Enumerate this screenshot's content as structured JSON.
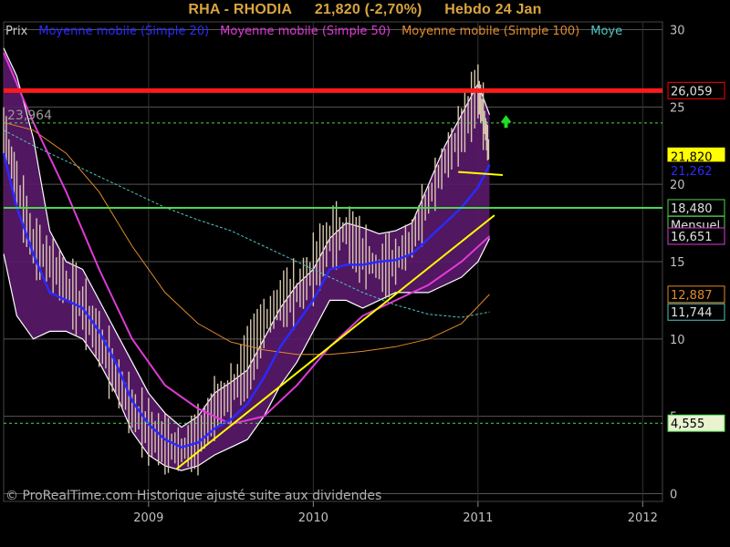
{
  "header": {
    "symbol": "RHA - RHODIA",
    "quote": "21,820 (-2,70%)",
    "period": "Hebdo  24 Jan"
  },
  "legend": [
    {
      "label": "Prix",
      "color": "#c8c8c8"
    },
    {
      "label": "Moyenne mobile (Simple 20)",
      "color": "#2a2aff"
    },
    {
      "label": "Moyenne mobile (Simple 50)",
      "color": "#e03ad8"
    },
    {
      "label": "Moyenne mobile (Simple 100)",
      "color": "#e08a2a"
    },
    {
      "label": "Moye",
      "color": "#4fc6c0"
    }
  ],
  "watermark": "© ProRealTime.com Historique ajusté suite aux dividendes",
  "left_level_label": "23,964",
  "price_tags": [
    {
      "label": "26,059",
      "bg": "#000000",
      "fg": "#e0e0e0",
      "border": "#ff0000",
      "value": 26.059
    },
    {
      "label": "21,820",
      "bg": "#ffff00",
      "fg": "#000000",
      "border": "#ffff00",
      "value": 21.82
    },
    {
      "label": "21,262",
      "bg": "#000000",
      "fg": "#2a2aff",
      "border": "#000000",
      "value": 20.9
    },
    {
      "label": "18,480",
      "bg": "#000000",
      "fg": "#e0e0e0",
      "border": "#4cd84c",
      "value": 18.48
    },
    {
      "label": "Mensuel",
      "bg": "#000000",
      "fg": "#e0e0e0",
      "border": "#4cd84c",
      "value": 17.4
    },
    {
      "label": "16,651",
      "bg": "#000000",
      "fg": "#e0e0e0",
      "border": "#e03ad8",
      "value": 16.651
    },
    {
      "label": "12,887",
      "bg": "#000000",
      "fg": "#e08a2a",
      "border": "#e08a2a",
      "value": 12.887
    },
    {
      "label": "11,744",
      "bg": "#000000",
      "fg": "#e0e0e0",
      "border": "#4fc6c0",
      "value": 11.744
    },
    {
      "label": "4,555",
      "bg": "#e8f3d0",
      "fg": "#000000",
      "border": "#4cd84c",
      "value": 4.555
    }
  ],
  "colors": {
    "background": "#000000",
    "price": "#d8c8b0",
    "band_fill": "#5a1a6a",
    "band_edge": "#ffffff",
    "sma20": "#2a2aff",
    "sma50": "#e03ad8",
    "sma100": "#e08a2a",
    "sma200": "#4fc6c0",
    "resistance": "#ff1a1a",
    "support_monthly": "#4cd84c",
    "trendline": "#ffff00",
    "grid": "#555555",
    "axis_text": "#c0c0c0"
  },
  "chart_data": {
    "type": "line",
    "xlim": [
      2008.12,
      2012.12
    ],
    "ylim": [
      -0.5,
      30.5
    ],
    "y_ticks": [
      0,
      5,
      10,
      15,
      20,
      25,
      30
    ],
    "x_ticks": [
      {
        "label": "2009",
        "value": 2009.0
      },
      {
        "label": "2010",
        "value": 2010.0
      },
      {
        "label": "2011",
        "value": 2011.0
      },
      {
        "label": "2012",
        "value": 2012.0
      }
    ],
    "series": [
      {
        "key": "price",
        "x": [
          2008.12,
          2008.2,
          2008.3,
          2008.4,
          2008.5,
          2008.6,
          2008.7,
          2008.8,
          2008.9,
          2009.0,
          2009.1,
          2009.2,
          2009.3,
          2009.4,
          2009.5,
          2009.6,
          2009.7,
          2009.8,
          2009.9,
          2010.0,
          2010.1,
          2010.2,
          2010.3,
          2010.4,
          2010.5,
          2010.6,
          2010.7,
          2010.8,
          2010.9,
          2011.0,
          2011.04,
          2011.07
        ],
        "y": [
          23.5,
          20.0,
          16.0,
          15.0,
          13.5,
          12.0,
          10.0,
          7.5,
          5.5,
          4.0,
          3.2,
          2.8,
          3.5,
          5.5,
          6.5,
          8.5,
          11.0,
          12.5,
          13.0,
          14.5,
          16.5,
          17.0,
          15.5,
          14.5,
          15.0,
          16.5,
          19.0,
          21.5,
          23.5,
          26.0,
          24.0,
          21.82
        ]
      },
      {
        "key": "sma20",
        "x": [
          2008.12,
          2008.2,
          2008.3,
          2008.4,
          2008.5,
          2008.6,
          2008.7,
          2008.8,
          2008.9,
          2009.0,
          2009.1,
          2009.2,
          2009.3,
          2009.4,
          2009.5,
          2009.6,
          2009.7,
          2009.8,
          2009.9,
          2010.0,
          2010.1,
          2010.2,
          2010.3,
          2010.4,
          2010.5,
          2010.6,
          2010.7,
          2010.8,
          2010.9,
          2011.0,
          2011.07
        ],
        "y": [
          22.0,
          18.5,
          15.5,
          13.0,
          12.5,
          12.0,
          10.5,
          8.5,
          6.0,
          4.5,
          3.5,
          3.0,
          3.3,
          4.2,
          4.8,
          5.8,
          7.5,
          9.5,
          11.0,
          12.5,
          14.5,
          14.8,
          14.8,
          15.0,
          15.1,
          15.5,
          16.5,
          17.5,
          18.5,
          19.8,
          21.26
        ]
      },
      {
        "key": "sma50",
        "x": [
          2008.12,
          2008.3,
          2008.5,
          2008.7,
          2008.9,
          2009.1,
          2009.3,
          2009.5,
          2009.7,
          2009.9,
          2010.1,
          2010.3,
          2010.5,
          2010.7,
          2010.9,
          2011.07
        ],
        "y": [
          28.5,
          24.0,
          19.5,
          14.5,
          10.0,
          7.0,
          5.5,
          4.5,
          5.0,
          7.0,
          9.5,
          11.5,
          12.5,
          13.5,
          15.0,
          16.651
        ]
      },
      {
        "key": "sma100",
        "x": [
          2008.12,
          2008.3,
          2008.5,
          2008.7,
          2008.9,
          2009.1,
          2009.3,
          2009.5,
          2009.7,
          2009.9,
          2010.1,
          2010.3,
          2010.5,
          2010.7,
          2010.9,
          2011.07
        ],
        "y": [
          24.0,
          23.5,
          22.0,
          19.5,
          16.0,
          13.0,
          11.0,
          9.8,
          9.3,
          9.0,
          9.0,
          9.2,
          9.5,
          10.0,
          11.0,
          12.887
        ]
      },
      {
        "key": "sma200",
        "x": [
          2008.12,
          2008.3,
          2008.5,
          2008.7,
          2008.9,
          2009.1,
          2009.3,
          2009.5,
          2009.7,
          2009.9,
          2010.1,
          2010.3,
          2010.5,
          2010.7,
          2010.9,
          2011.07
        ],
        "y": [
          23.5,
          22.5,
          21.5,
          20.5,
          19.5,
          18.5,
          17.7,
          17.0,
          16.0,
          15.0,
          14.0,
          13.0,
          12.2,
          11.6,
          11.4,
          11.744
        ]
      },
      {
        "key": "band_upper",
        "x": [
          2008.12,
          2008.2,
          2008.3,
          2008.4,
          2008.5,
          2008.6,
          2008.7,
          2008.8,
          2008.9,
          2009.0,
          2009.1,
          2009.2,
          2009.3,
          2009.4,
          2009.5,
          2009.6,
          2009.7,
          2009.8,
          2009.9,
          2010.0,
          2010.1,
          2010.2,
          2010.3,
          2010.4,
          2010.5,
          2010.6,
          2010.7,
          2010.8,
          2010.9,
          2011.0,
          2011.07
        ],
        "y": [
          28.8,
          27.0,
          23.0,
          17.0,
          15.0,
          14.5,
          12.5,
          10.5,
          8.5,
          6.5,
          5.2,
          4.3,
          5.0,
          6.5,
          7.2,
          8.0,
          10.0,
          12.0,
          13.5,
          14.5,
          16.5,
          17.5,
          17.2,
          16.8,
          17.0,
          17.5,
          20.0,
          22.5,
          24.5,
          26.5,
          24.5
        ]
      },
      {
        "key": "band_lower",
        "x": [
          2008.12,
          2008.2,
          2008.3,
          2008.4,
          2008.5,
          2008.6,
          2008.7,
          2008.8,
          2008.9,
          2009.0,
          2009.1,
          2009.2,
          2009.3,
          2009.4,
          2009.5,
          2009.6,
          2009.7,
          2009.8,
          2009.9,
          2010.0,
          2010.1,
          2010.2,
          2010.3,
          2010.4,
          2010.5,
          2010.6,
          2010.7,
          2010.8,
          2010.9,
          2011.0,
          2011.07
        ],
        "y": [
          15.5,
          11.5,
          10.0,
          10.5,
          10.5,
          10.0,
          8.5,
          6.5,
          4.0,
          2.5,
          1.8,
          1.5,
          1.8,
          2.5,
          3.0,
          3.5,
          5.0,
          7.0,
          8.5,
          10.5,
          12.5,
          12.5,
          12.0,
          12.5,
          13.0,
          13.0,
          13.0,
          13.5,
          14.0,
          15.0,
          16.5
        ]
      }
    ],
    "levels": [
      {
        "key": "resistance",
        "value": 26.059,
        "style": "solid"
      },
      {
        "key": "upper_dashed",
        "value": 23.964,
        "style": "dashed"
      },
      {
        "key": "monthly_support",
        "value": 18.48,
        "style": "solid"
      },
      {
        "key": "lower_dashed",
        "value": 4.555,
        "style": "dashed"
      }
    ],
    "trendline": {
      "x": [
        2009.17,
        2011.1
      ],
      "y": [
        1.6,
        18.0
      ]
    },
    "short_line": {
      "x": [
        2010.88,
        2011.15
      ],
      "y": [
        20.8,
        20.6
      ]
    },
    "arrow": {
      "x": 2011.17,
      "y": 24.0,
      "direction": "up"
    }
  }
}
